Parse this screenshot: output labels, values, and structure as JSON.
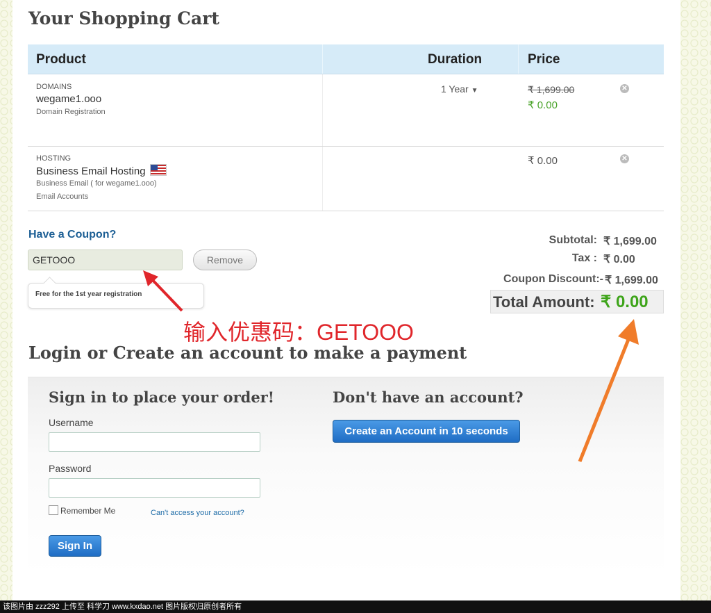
{
  "cart": {
    "title": "Your Shopping Cart",
    "headers": {
      "product": "Product",
      "duration": "Duration",
      "price": "Price"
    },
    "items": [
      {
        "category": "DOMAINS",
        "name": "wegame1.ooo",
        "desc1": "Domain Registration",
        "desc2": "",
        "duration": "1 Year",
        "price_old": "₹ 1,699.00",
        "price": "₹ 0.00"
      },
      {
        "category": "HOSTING",
        "name": "Business Email Hosting",
        "desc1": "Business Email ( for wegame1.ooo)",
        "desc2": "Email Accounts",
        "duration": "",
        "price_old": "",
        "price": "₹ 0.00"
      }
    ]
  },
  "coupon": {
    "title": "Have a Coupon?",
    "value": "GETOOO",
    "remove_label": "Remove",
    "tooltip": "Free for the 1st year registration"
  },
  "summary": {
    "subtotal_label": "Subtotal:",
    "subtotal_value": "₹ 1,699.00",
    "tax_label": "Tax :",
    "tax_value": "₹ 0.00",
    "discount_label": "Coupon Discount:-",
    "discount_value": "₹ 1,699.00",
    "total_label": "Total Amount:",
    "total_value": "₹ 0.00"
  },
  "annotation": "输入优惠码：GETOOO",
  "login": {
    "heading": "Login or Create an account to make a payment",
    "signin_title": "Sign in to place your order!",
    "username_label": "Username",
    "password_label": "Password",
    "remember_label": "Remember Me",
    "cant_access": "Can't access your account?",
    "signin_button": "Sign In",
    "noaccount_title": "Don't have an account?",
    "create_button": "Create an Account in 10 seconds"
  },
  "watermark": "该图片由 zzz292 上传至 科学刀 www.kxdao.net 图片版权归原创者所有",
  "colors": {
    "annotation_red": "#e0262b",
    "annotation_orange": "#f07c2a",
    "price_green": "#4aa32a",
    "button_blue": "#1f6dc4"
  }
}
